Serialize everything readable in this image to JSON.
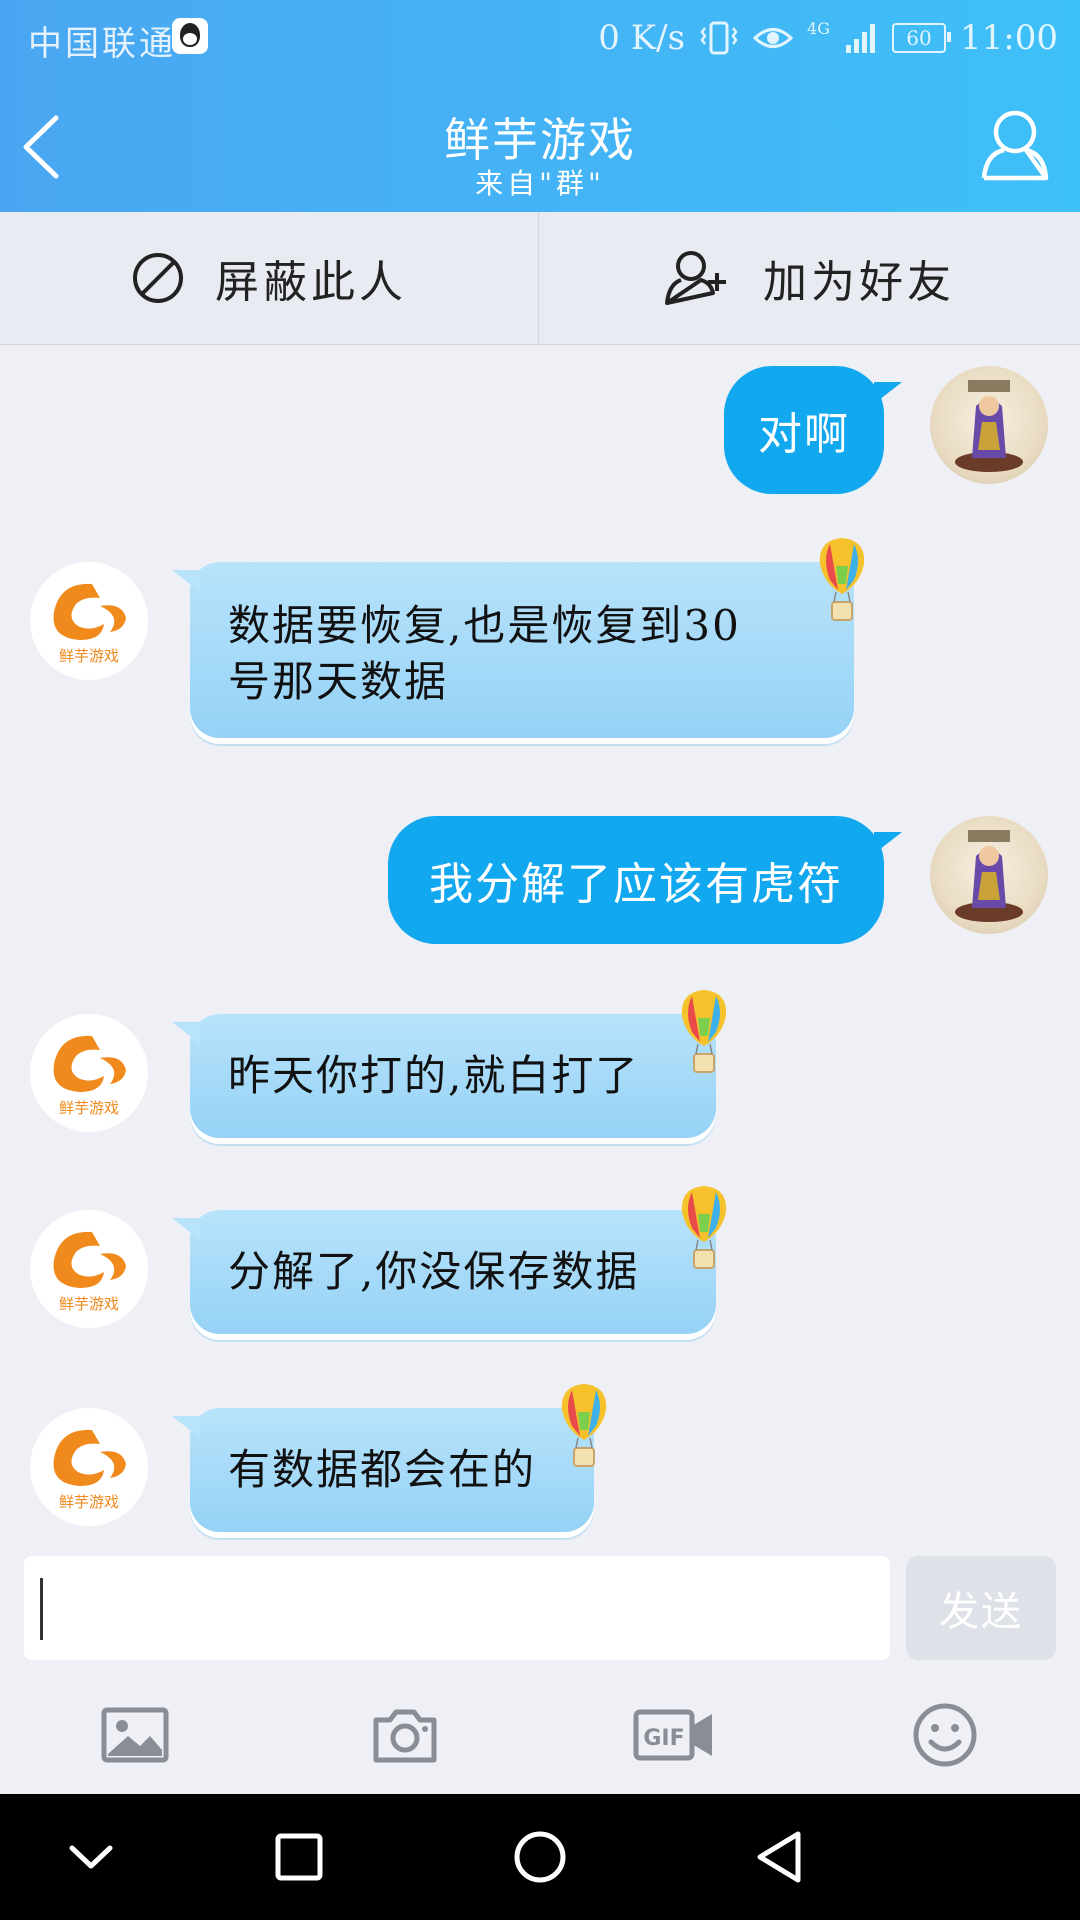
{
  "status_bar": {
    "carrier": "中国联通",
    "speed": "0 K/s",
    "network": "4G",
    "battery": "60",
    "time": "11:00"
  },
  "header": {
    "title": "鲜芋游戏",
    "subtitle": "来自\"群\""
  },
  "actions": {
    "block_label": "屏蔽此人",
    "add_friend_label": "加为好友"
  },
  "contact": {
    "avatar_label": "鲜芋游戏"
  },
  "messages": [
    {
      "from": "me",
      "text": "对啊"
    },
    {
      "from": "other",
      "lines": [
        "数据要恢复,也是恢复到30",
        "号那天数据"
      ]
    },
    {
      "from": "me",
      "text": "我分解了应该有虎符"
    },
    {
      "from": "other",
      "text": "昨天你打的,就白打了"
    },
    {
      "from": "other",
      "text": "分解了,你没保存数据"
    },
    {
      "from": "other",
      "text": "有数据都会在的"
    }
  ],
  "composer": {
    "value": "",
    "send_label": "发送"
  },
  "toolbar": [
    "image-icon",
    "camera-icon",
    "gif-icon",
    "emoji-icon"
  ],
  "colors": {
    "header_gradient_start": "#4aa6f2",
    "header_gradient_end": "#3ec0f8",
    "my_bubble": "#12a8f0",
    "other_bubble": "#a8dcf9",
    "brand_orange": "#f08a1c"
  }
}
